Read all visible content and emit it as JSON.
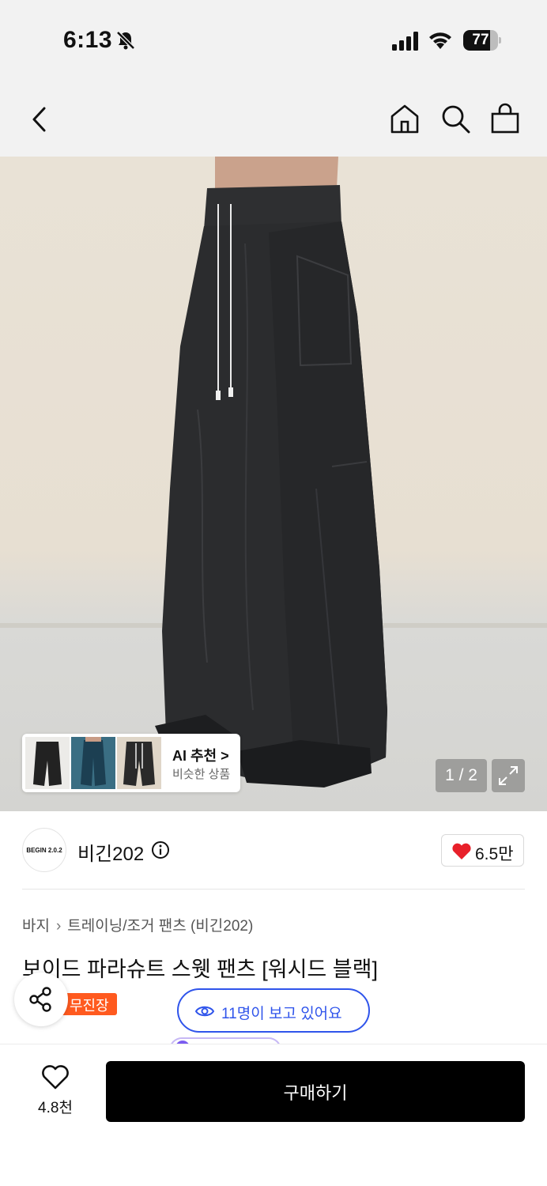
{
  "status_bar": {
    "time": "6:13",
    "battery_level": "77",
    "battery_fraction": 0.77,
    "icons": [
      "bell-slash-icon",
      "signal-icon",
      "wifi-icon",
      "battery-icon"
    ]
  },
  "nav": {
    "icons": [
      "back-icon",
      "home-icon",
      "search-icon",
      "bag-icon"
    ]
  },
  "hero": {
    "image_counter": "1 / 2",
    "ai_card": {
      "title": "AI 추천 >",
      "subtitle": "비슷한 상품"
    }
  },
  "brand": {
    "logo_text": "BEGIN 2.0.2",
    "name": "비긴202",
    "likes": "6.5만"
  },
  "breadcrumb": {
    "category": "바지",
    "subcategory": "트레이닝/조거 팬츠 (비긴202)"
  },
  "product": {
    "title": "보이드 파라슈트 스웻 팬츠 [워시드 블랙]",
    "badge": "무진장",
    "viewers": "11명이 보고 있어요"
  },
  "bottom": {
    "wish_count": "4.8천",
    "buy_label": "구매하기"
  },
  "colors": {
    "accent_blue": "#2f54eb",
    "badge_orange": "#ff5a1f",
    "heart_red": "#e8202a",
    "buy_black": "#000000"
  }
}
